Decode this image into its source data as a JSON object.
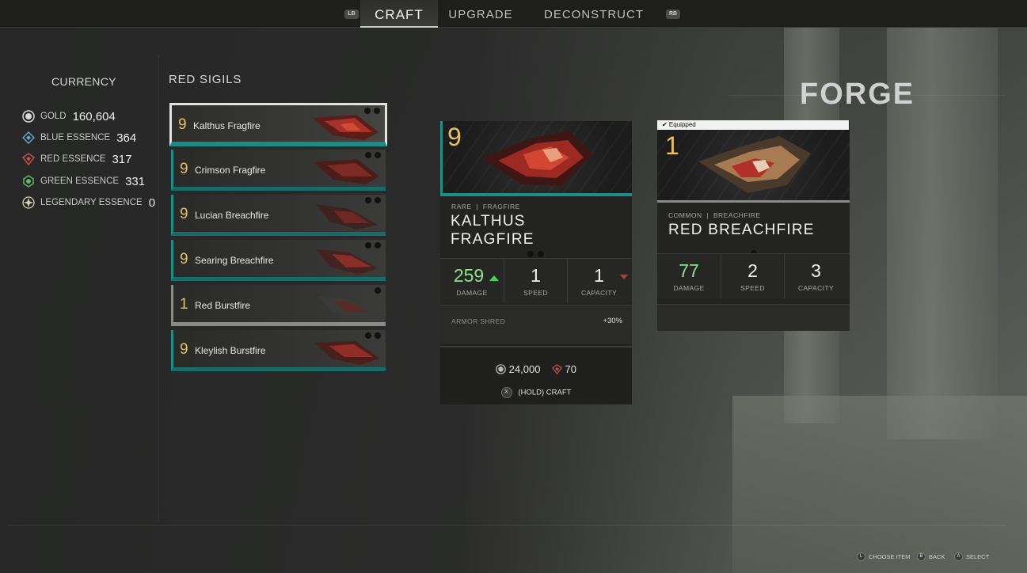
{
  "tabs": {
    "left_bumper": "LB",
    "right_bumper": "RB",
    "items": [
      {
        "label": "CRAFT",
        "active": true
      },
      {
        "label": "UPGRADE",
        "active": false
      },
      {
        "label": "DECONSTRUCT",
        "active": false
      }
    ]
  },
  "screen_title": "FORGE",
  "currency": {
    "heading": "CURRENCY",
    "items": [
      {
        "name": "GOLD",
        "value": "160,604",
        "icon": "gold-coin-icon",
        "color": "#d9d9d9"
      },
      {
        "name": "BLUE ESSENCE",
        "value": "364",
        "icon": "blue-essence-icon",
        "color": "#6aa6c8"
      },
      {
        "name": "RED ESSENCE",
        "value": "317",
        "icon": "red-essence-icon",
        "color": "#c0554f"
      },
      {
        "name": "GREEN ESSENCE",
        "value": "331",
        "icon": "green-essence-icon",
        "color": "#5db86b"
      },
      {
        "name": "LEGENDARY ESSENCE",
        "value": "0",
        "icon": "legendary-essence-icon",
        "color": "#d8d0b8"
      }
    ]
  },
  "sigils": {
    "heading": "RED SIGILS",
    "items": [
      {
        "level": "9",
        "name": "Kalthus Fragfire",
        "selected": true,
        "dots": 2,
        "rarity": "rare"
      },
      {
        "level": "9",
        "name": "Crimson Fragfire",
        "selected": false,
        "dots": 2,
        "rarity": "rare"
      },
      {
        "level": "9",
        "name": "Lucian Breachfire",
        "selected": false,
        "dots": 2,
        "rarity": "rare"
      },
      {
        "level": "9",
        "name": "Searing Breachfire",
        "selected": false,
        "dots": 2,
        "rarity": "rare"
      },
      {
        "level": "1",
        "name": "Red Burstfire",
        "selected": false,
        "dots": 1,
        "rarity": "common"
      },
      {
        "level": "9",
        "name": "Kleylish Burstfire",
        "selected": false,
        "dots": 2,
        "rarity": "rare"
      }
    ]
  },
  "craft_card": {
    "level": "9",
    "rarity": "RARE",
    "type": "FRAGFIRE",
    "title_line1": "KALTHUS",
    "title_line2": "FRAGFIRE",
    "stats": [
      {
        "value": "259",
        "label": "DAMAGE",
        "trend": "up"
      },
      {
        "value": "1",
        "label": "SPEED",
        "trend": "none"
      },
      {
        "value": "1",
        "label": "CAPACITY",
        "trend": "down"
      }
    ],
    "perk": {
      "name": "ARMOR SHRED",
      "value": "+30%"
    },
    "cost_gold": "24,000",
    "cost_red": "70",
    "craft_button_glyph": "X",
    "craft_label": "(HOLD) CRAFT"
  },
  "equipped_card": {
    "equipped_label": "✔ Equipped",
    "level": "1",
    "rarity": "COMMON",
    "type": "BREACHFIRE",
    "title": "RED BREACHFIRE",
    "stats": [
      {
        "value": "77",
        "label": "DAMAGE"
      },
      {
        "value": "2",
        "label": "SPEED"
      },
      {
        "value": "3",
        "label": "CAPACITY"
      }
    ]
  },
  "footer_hints": [
    {
      "key": "L",
      "label": "CHOOSE ITEM"
    },
    {
      "key": "B",
      "label": "BACK"
    },
    {
      "key": "A",
      "label": "SELECT"
    }
  ]
}
